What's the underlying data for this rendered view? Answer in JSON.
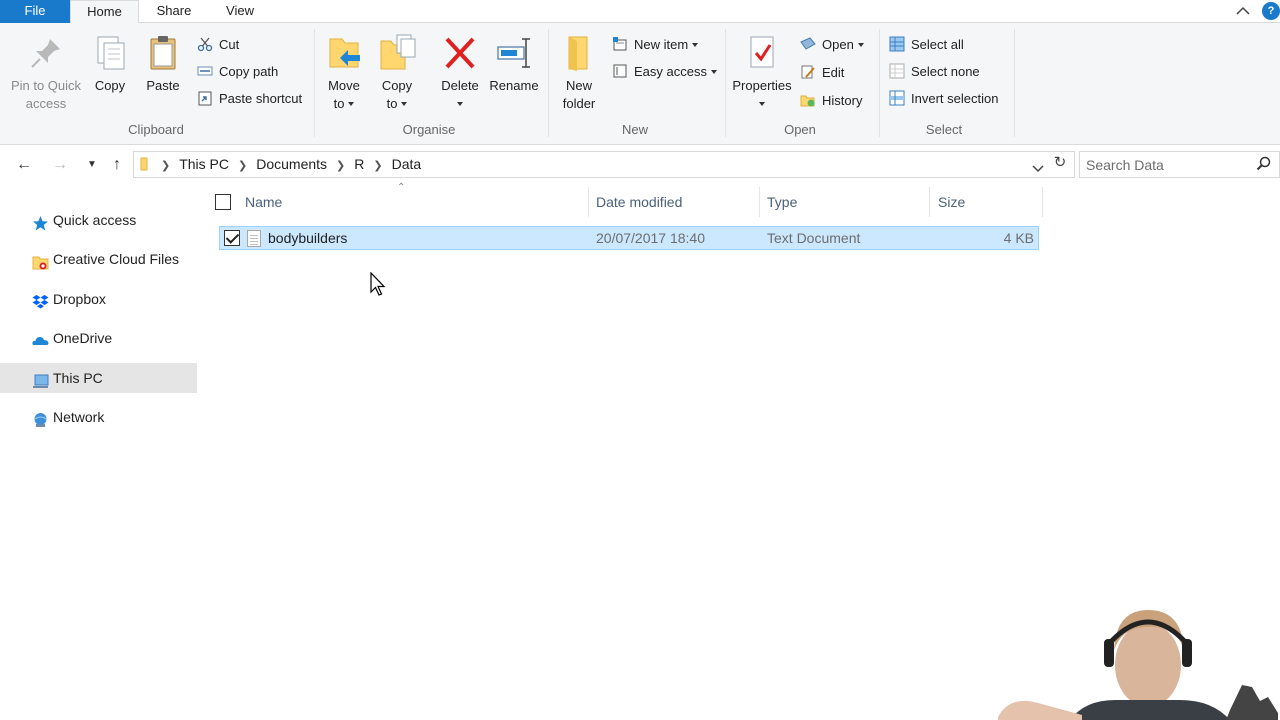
{
  "tabs": {
    "file": "File",
    "home": "Home",
    "share": "Share",
    "view": "View"
  },
  "help_label": "?",
  "ribbon": {
    "clipboard": {
      "label": "Clipboard",
      "pin_line1": "Pin to Quick",
      "pin_line2": "access",
      "copy": "Copy",
      "paste": "Paste",
      "cut": "Cut",
      "copy_path": "Copy path",
      "paste_shortcut": "Paste shortcut"
    },
    "organise": {
      "label": "Organise",
      "move_line1": "Move",
      "move_line2": "to",
      "copy_line1": "Copy",
      "copy_line2": "to",
      "delete": "Delete",
      "rename": "Rename"
    },
    "new": {
      "label": "New",
      "folder_line1": "New",
      "folder_line2": "folder",
      "new_item": "New item",
      "easy_access": "Easy access"
    },
    "open": {
      "label": "Open",
      "properties": "Properties",
      "open": "Open",
      "edit": "Edit",
      "history": "History"
    },
    "select": {
      "label": "Select",
      "select_all": "Select all",
      "select_none": "Select none",
      "invert": "Invert selection"
    }
  },
  "address": {
    "crumbs": [
      "This PC",
      "Documents",
      "R",
      "Data"
    ]
  },
  "search": {
    "placeholder": "Search Data"
  },
  "nav": {
    "items": [
      {
        "label": "Quick access",
        "icon": "star-icon"
      },
      {
        "label": "Creative Cloud Files",
        "icon": "creative-cloud-folder-icon"
      },
      {
        "label": "Dropbox",
        "icon": "dropbox-icon"
      },
      {
        "label": "OneDrive",
        "icon": "onedrive-icon"
      },
      {
        "label": "This PC",
        "icon": "computer-icon",
        "selected": true
      },
      {
        "label": "Network",
        "icon": "network-icon"
      }
    ]
  },
  "columns": {
    "name": "Name",
    "date": "Date modified",
    "type": "Type",
    "size": "Size"
  },
  "files": [
    {
      "name": "bodybuilders",
      "date": "20/07/2017 18:40",
      "type": "Text Document",
      "size": "4 KB",
      "selected": true
    }
  ],
  "colors": {
    "accent": "#1979ca",
    "selection": "#cce8ff",
    "selection_border": "#99d1ff",
    "ribbon_bg": "#f5f6f7"
  }
}
